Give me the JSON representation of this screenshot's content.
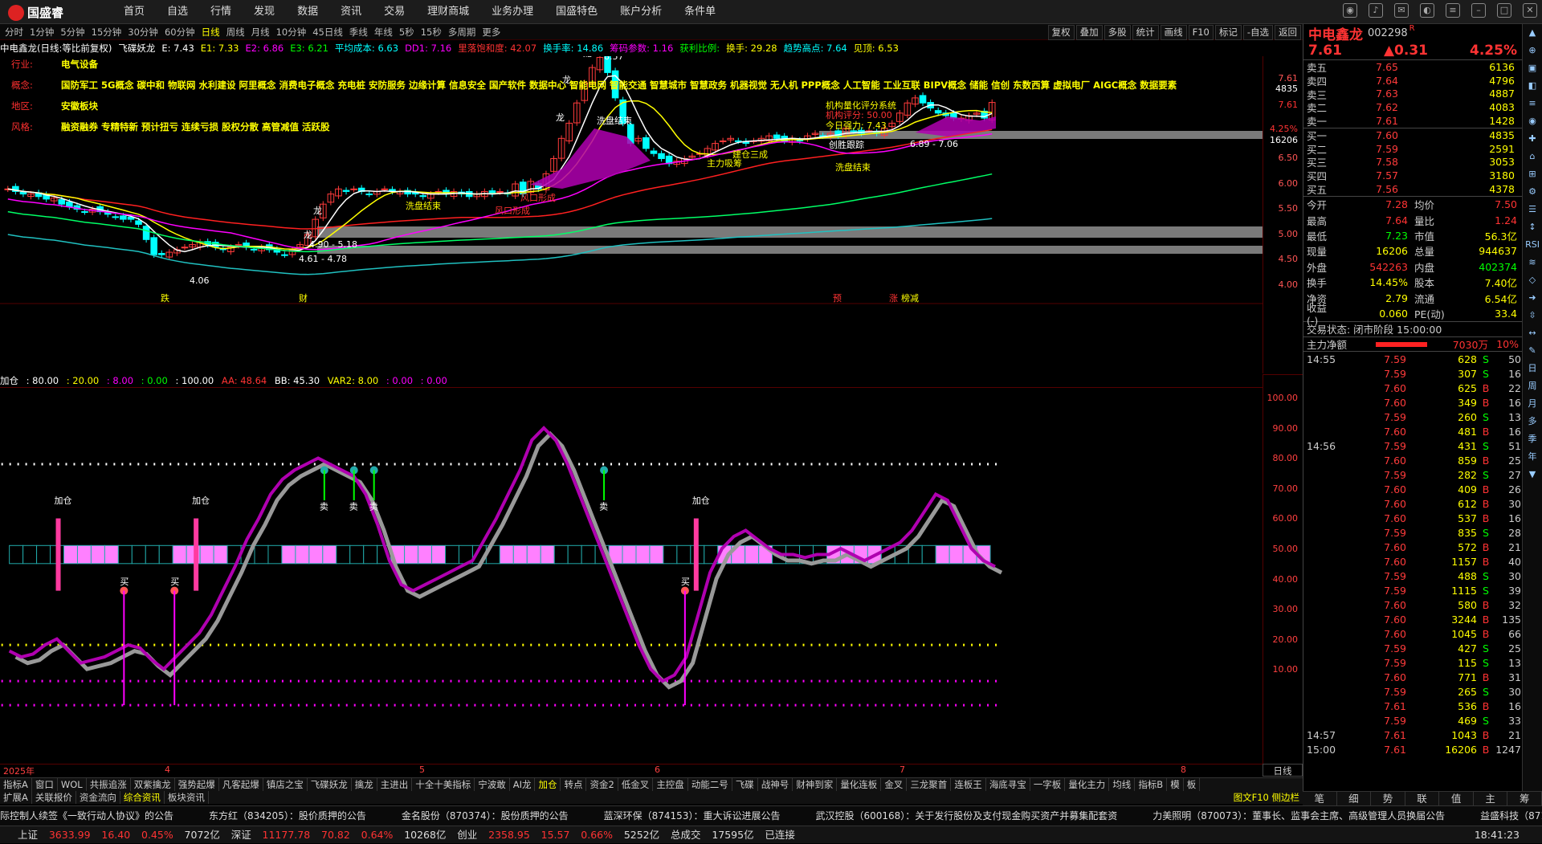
{
  "app": {
    "logo": "国盛睿"
  },
  "menu": [
    "首页",
    "自选",
    "行情",
    "发现",
    "数据",
    "资讯",
    "交易",
    "理财商城",
    "业务办理",
    "国盛特色",
    "账户分析",
    "条件单"
  ],
  "periods": [
    "分时",
    "1分钟",
    "5分钟",
    "15分钟",
    "30分钟",
    "60分钟",
    "日线",
    "周线",
    "月线",
    "10分钟",
    "45日线",
    "季线",
    "年线",
    "5秒",
    "15秒",
    "多周期",
    "更多"
  ],
  "active_period": "日线",
  "tools": [
    "复权",
    "叠加",
    "多股",
    "统计",
    "画线",
    "F10",
    "标记",
    "-自选",
    "返回"
  ],
  "title": {
    "name": "中电鑫龙(日线:等比前复权)",
    "indicator": "飞碟妖龙",
    "e": "E: 7.43",
    "e1": "E1: 7.33",
    "e2": "E2: 6.86",
    "e3": "E3: 6.21",
    "avgcost": "平均成本: 6.63",
    "dd1": "DD1: 7.16",
    "limit_rate": "里落饱和度: 42.07",
    "turnover": "换手率: 14.86",
    "chip": "筹码参数: 1.16",
    "profit": "获利比例:",
    "hand": "换手: 29.28",
    "trend_high": "趋势高点: 7.64",
    "top_sell": "见顶: 6.53"
  },
  "info": [
    {
      "k": "行业:",
      "v": "电气设备"
    },
    {
      "k": "概念:",
      "v": "国防军工 5G概念 碳中和 物联网 水利建设 阿里概念 消费电子概念 充电桩 安防服务 边缘计算 信息安全 国产软件 数据中心 智能电网 智能交通 智慧城市 智慧政务 机器视觉 无人机 PPP概念 人工智能 工业互联 BIPV概念 储能 信创 东数西算 虚拟电厂 AIGC概念 数据要素"
    },
    {
      "k": "地区:",
      "v": "安徽板块"
    },
    {
      "k": "风格:",
      "v": "融资融券 专精特新 预计扭亏 连续亏损 股权分散 高管减值 活跃股"
    }
  ],
  "price_ticks": [
    "7.61",
    "6.50",
    "6.00",
    "5.50",
    "5.00",
    "4.50",
    "4.00"
  ],
  "price_overlay": {
    "p1": "7.61",
    "p2": "4.25%",
    "p3": "16206",
    "p4": "4835"
  },
  "annotations": {
    "high": "8.57",
    "low": "4.06",
    "r1": "4.90 - 5.18",
    "r2": "4.61 - 4.78",
    "r3": "6.89 - 7.06",
    "long": "龙",
    "wash1": "洗盘结束",
    "wash2": "洗盘结束",
    "wash3": "洗盘结束",
    "risk1": "风口形成",
    "risk2": "风口形成",
    "build": "建仓三成",
    "main_absorb": "主力吸筹",
    "inst": "机构量化评分系统",
    "inst_score": "机构评分: 50.00",
    "today_power": "今日强力: 7.43",
    "hold": "创胜跟踪",
    "bottom1": "跌",
    "bottom2": "财",
    "bottom3": "预",
    "bottom4": "涨",
    "bottom5": "榜减"
  },
  "sub_header": {
    "name": "加仓",
    "v1": ": 80.00",
    "v2": ": 20.00",
    "v3": ": 8.00",
    "v4": ": 0.00",
    "v5": ": 100.00",
    "aa": "AA: 48.64",
    "bb": "BB: 45.30",
    "var2": "VAR2: 8.00",
    "v6": ": 0.00",
    "v7": ": 0.00"
  },
  "sub_ticks": [
    "100.00",
    "90.00",
    "80.00",
    "70.00",
    "60.00",
    "50.00",
    "40.00",
    "30.00",
    "20.00",
    "10.00"
  ],
  "sub_labels": {
    "add": "加仓",
    "buy": "买",
    "sell": "卖"
  },
  "x_labels": [
    "2025年",
    "4",
    "5",
    "6",
    "7",
    "8"
  ],
  "day_label": "日线",
  "ind_tabs": [
    "指标A",
    "窗口",
    "WOL",
    "共振追涨",
    "双紫擒龙",
    "强势起爆",
    "凡客起爆",
    "镇店之宝",
    "飞碟妖龙",
    "擒龙",
    "主进出",
    "十全十美指标",
    "宁波敢",
    "AI龙",
    "加仓",
    "转点",
    "资金2",
    "低金叉",
    "主控盘",
    "动能二号",
    "飞碟",
    "战神号",
    "财神到家",
    "量化连板",
    "金叉",
    "三龙聚首",
    "连板王",
    "海底寻宝",
    "一字板",
    "量化主力",
    "均线",
    "指标B",
    "模",
    "板"
  ],
  "ind_active": "加仓",
  "ex_tabs": [
    "扩展A",
    "关联报价",
    "资金流向",
    "综合资讯",
    "板块资讯"
  ],
  "ex_active": "综合资讯",
  "ex_right": "图文F10  侧边栏",
  "ticker": [
    "际控制人续签《一致行动人协议》的公告",
    "东方红（834205）：股价质押的公告",
    "金名股份（870374）：股份质押的公告",
    "蓝深环保（874153）：重大诉讼进展公告",
    "武汉控股（600168）：关于发行股份及支付现金购买资产并募集配套资",
    "力美照明（870073）：董事长、监事会主席、高级管理人员换届公告",
    "益盛科技（871169"
  ],
  "status": {
    "sh_label": "上证",
    "sh": "3633.99",
    "sh_chg": "16.40",
    "sh_pct": "0.45%",
    "sh_amt": "7072亿",
    "sz_label": "深证",
    "sz": "11177.78",
    "sz_chg": "70.82",
    "sz_pct": "0.64%",
    "sz_amt": "10268亿",
    "cy_label": "创业",
    "cy": "2358.95",
    "cy_chg": "15.57",
    "cy_pct": "0.66%",
    "cy_amt": "5252亿",
    "total_label": "总成交",
    "total": "17595亿",
    "conn": "已连接",
    "time": "18:41:23"
  },
  "stock": {
    "name": "中电鑫龙",
    "code": "002298",
    "flag": "R",
    "price": "7.61",
    "change": "▲0.31",
    "pct": "4.25%"
  },
  "orderbook": {
    "asks": [
      {
        "l": "卖五",
        "p": "7.65",
        "v": "6136"
      },
      {
        "l": "卖四",
        "p": "7.64",
        "v": "4796"
      },
      {
        "l": "卖三",
        "p": "7.63",
        "v": "4887"
      },
      {
        "l": "卖二",
        "p": "7.62",
        "v": "4083"
      },
      {
        "l": "卖一",
        "p": "7.61",
        "v": "1428"
      }
    ],
    "bids": [
      {
        "l": "买一",
        "p": "7.60",
        "v": "4835"
      },
      {
        "l": "买二",
        "p": "7.59",
        "v": "2591"
      },
      {
        "l": "买三",
        "p": "7.58",
        "v": "3053"
      },
      {
        "l": "买四",
        "p": "7.57",
        "v": "3180"
      },
      {
        "l": "买五",
        "p": "7.56",
        "v": "4378"
      }
    ]
  },
  "stats": [
    {
      "a": "今开",
      "b": "7.28",
      "c": "均价",
      "d": "7.50"
    },
    {
      "a": "最高",
      "b": "7.64",
      "c": "量比",
      "d": "1.24"
    },
    {
      "a": "最低",
      "b": "7.23",
      "c": "市值",
      "d": "56.3亿"
    },
    {
      "a": "现量",
      "b": "16206",
      "c": "总量",
      "d": "944637"
    },
    {
      "a": "外盘",
      "b": "542263",
      "c": "内盘",
      "d": "402374"
    },
    {
      "a": "换手",
      "b": "14.45%",
      "c": "股本",
      "d": "7.40亿"
    },
    {
      "a": "净资",
      "b": "2.79",
      "c": "流通",
      "d": "6.54亿"
    },
    {
      "a": "收益(-)",
      "b": "0.060",
      "c": "PE(动)",
      "d": "33.4"
    }
  ],
  "trade_state": "交易状态: 闭市阶段 15:00:00",
  "net_flow": {
    "label": "主力净额",
    "value": "7030万",
    "pct": "10%"
  },
  "ticks": [
    {
      "t": "14:55",
      "p": "7.59",
      "v": "628",
      "s": "S",
      "n": "50"
    },
    {
      "t": "",
      "p": "7.59",
      "v": "307",
      "s": "S",
      "n": "16"
    },
    {
      "t": "",
      "p": "7.60",
      "v": "625",
      "s": "B",
      "n": "22"
    },
    {
      "t": "",
      "p": "7.60",
      "v": "349",
      "s": "B",
      "n": "16"
    },
    {
      "t": "",
      "p": "7.59",
      "v": "260",
      "s": "S",
      "n": "13"
    },
    {
      "t": "",
      "p": "7.60",
      "v": "481",
      "s": "B",
      "n": "16"
    },
    {
      "t": "14:56",
      "p": "7.59",
      "v": "431",
      "s": "S",
      "n": "51"
    },
    {
      "t": "",
      "p": "7.60",
      "v": "859",
      "s": "B",
      "n": "25"
    },
    {
      "t": "",
      "p": "7.59",
      "v": "282",
      "s": "S",
      "n": "27"
    },
    {
      "t": "",
      "p": "7.60",
      "v": "409",
      "s": "B",
      "n": "26"
    },
    {
      "t": "",
      "p": "7.60",
      "v": "612",
      "s": "B",
      "n": "30"
    },
    {
      "t": "",
      "p": "7.60",
      "v": "537",
      "s": "B",
      "n": "16"
    },
    {
      "t": "",
      "p": "7.59",
      "v": "835",
      "s": "S",
      "n": "28"
    },
    {
      "t": "",
      "p": "7.60",
      "v": "572",
      "s": "B",
      "n": "21"
    },
    {
      "t": "",
      "p": "7.60",
      "v": "1157",
      "s": "B",
      "n": "40"
    },
    {
      "t": "",
      "p": "7.59",
      "v": "488",
      "s": "S",
      "n": "30"
    },
    {
      "t": "",
      "p": "7.59",
      "v": "1115",
      "s": "S",
      "n": "39"
    },
    {
      "t": "",
      "p": "7.60",
      "v": "580",
      "s": "B",
      "n": "32"
    },
    {
      "t": "",
      "p": "7.60",
      "v": "3244",
      "s": "B",
      "n": "135"
    },
    {
      "t": "",
      "p": "7.60",
      "v": "1045",
      "s": "B",
      "n": "66"
    },
    {
      "t": "",
      "p": "7.59",
      "v": "427",
      "s": "S",
      "n": "25"
    },
    {
      "t": "",
      "p": "7.59",
      "v": "115",
      "s": "S",
      "n": "13"
    },
    {
      "t": "",
      "p": "7.60",
      "v": "771",
      "s": "B",
      "n": "31"
    },
    {
      "t": "",
      "p": "7.59",
      "v": "265",
      "s": "S",
      "n": "30"
    },
    {
      "t": "",
      "p": "7.61",
      "v": "536",
      "s": "B",
      "n": "16"
    },
    {
      "t": "",
      "p": "7.59",
      "v": "469",
      "s": "S",
      "n": "33"
    },
    {
      "t": "14:57",
      "p": "7.61",
      "v": "1043",
      "s": "B",
      "n": "21"
    },
    {
      "t": "15:00",
      "p": "7.61",
      "v": "16206",
      "s": "B",
      "n": "1247"
    }
  ],
  "rp_tabs": [
    "笔",
    "细",
    "势",
    "联",
    "值",
    "主",
    "筹"
  ],
  "side_icons": [
    "▲",
    "⊕",
    "▣",
    "◧",
    "≡",
    "◉",
    "✚",
    "⌂",
    "⊞",
    "⚙",
    "☰",
    "↕",
    "RSI",
    "≋",
    "◇",
    "➜",
    "⇳",
    "↔",
    "✎",
    "日",
    "周",
    "月",
    "多",
    "季",
    "年",
    "▼"
  ],
  "colors": {
    "up": "#ff3b3b",
    "down": "#00ffff",
    "yellow": "#ffff00",
    "magenta": "#ff00ff",
    "green": "#00ff00",
    "purple": "#b000b0",
    "gray": "#999999"
  }
}
